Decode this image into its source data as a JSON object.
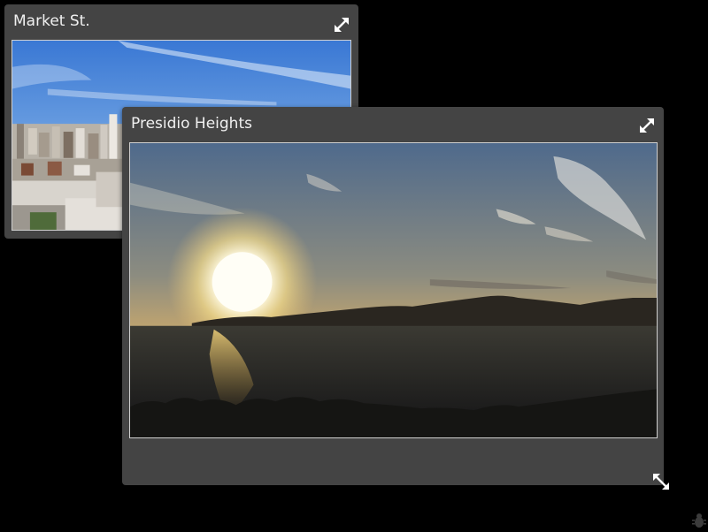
{
  "windows": [
    {
      "title": "Market St.",
      "expand_icon": "expand-arrows-icon",
      "photo_subject": "city skyline under blue sky"
    },
    {
      "title": "Presidio Heights",
      "expand_icon": "expand-arrows-icon",
      "resize_icon": "diagonal-resize-icon",
      "photo_subject": "sunset over bay with hills"
    }
  ],
  "corner_icon": "bug-icon",
  "colors": {
    "window_bg": "#444444",
    "desktop_bg": "#000000",
    "title_text": "#f0f0f0"
  }
}
